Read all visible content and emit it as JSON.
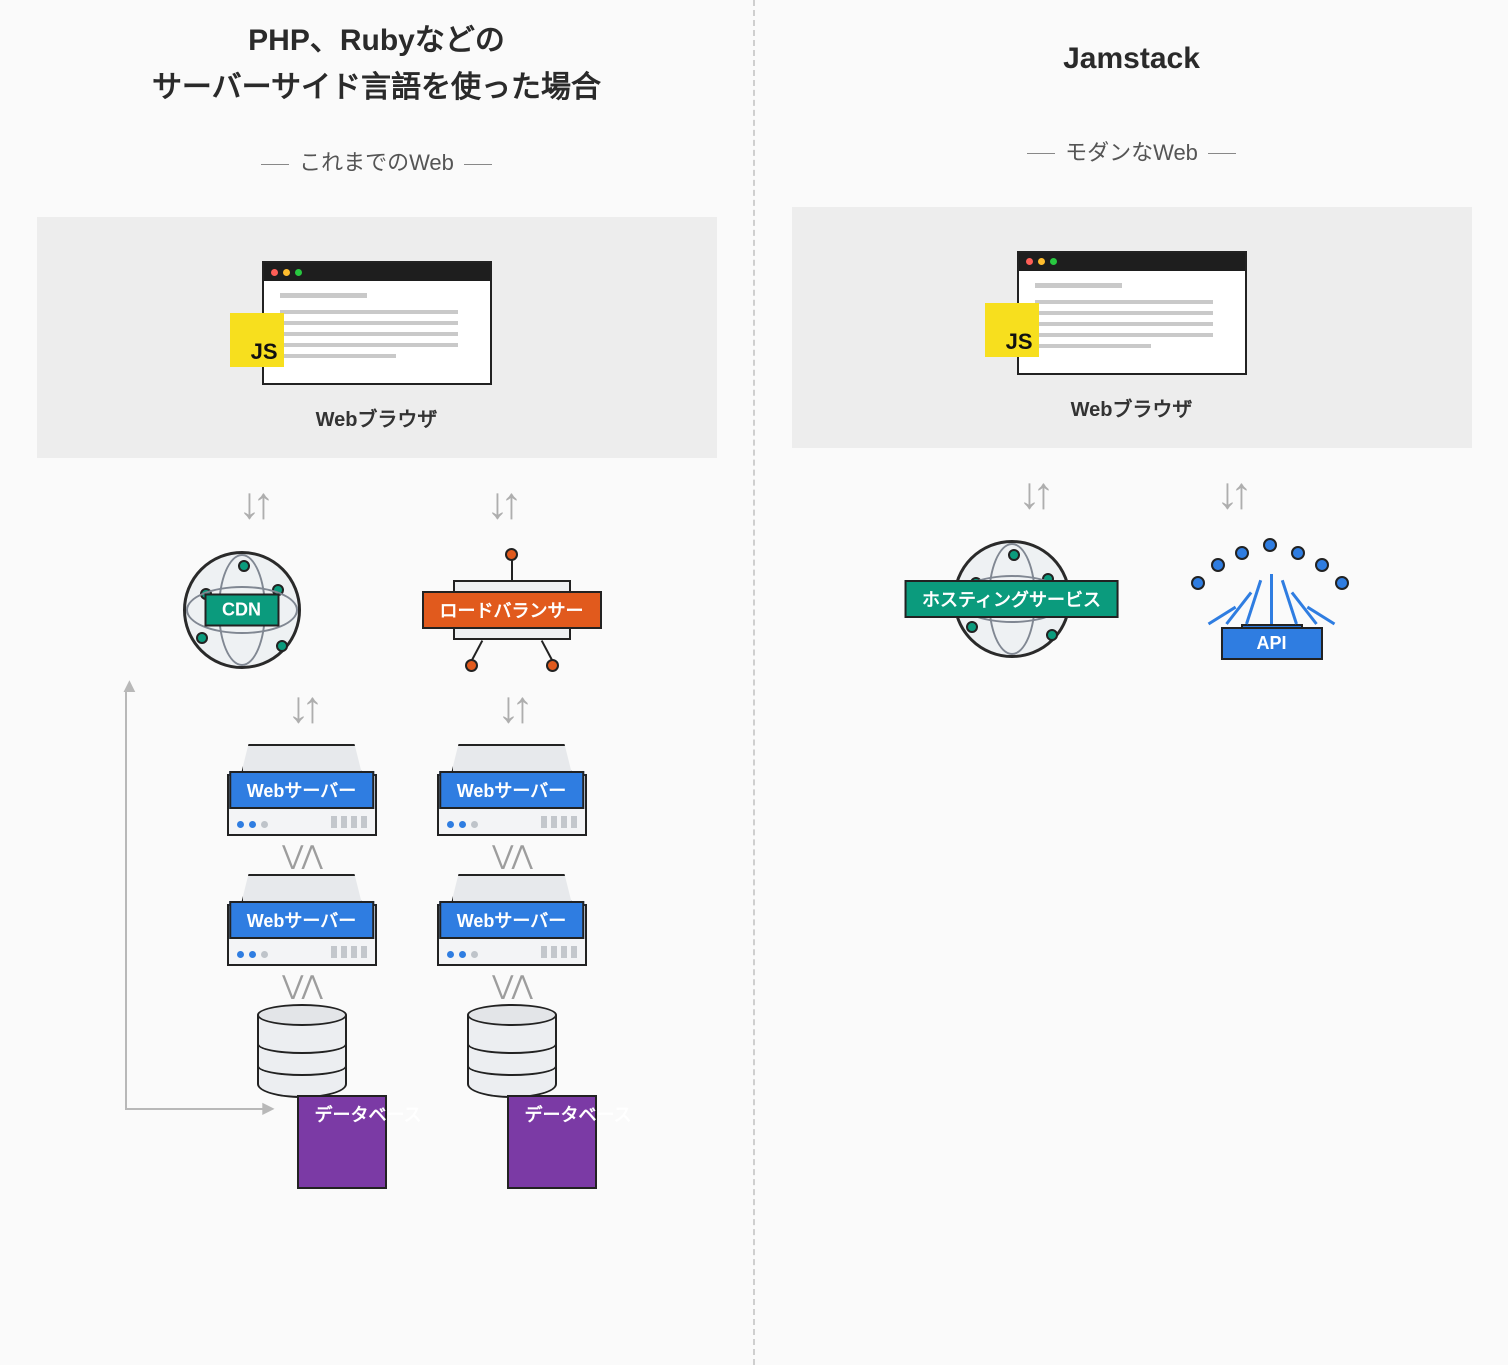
{
  "left": {
    "title_line1": "PHP、Rubyなどの",
    "title_line2": "サーバーサイド言語を使った場合",
    "subtitle": "これまでのWeb",
    "js_badge": "JS",
    "browser_label": "Webブラウザ",
    "nodes": {
      "cdn": "CDN",
      "load_balancer": "ロードバランサー",
      "web_server": "Webサーバー",
      "database": "データベース"
    }
  },
  "right": {
    "title": "Jamstack",
    "subtitle": "モダンなWeb",
    "js_badge": "JS",
    "browser_label": "Webブラウザ",
    "nodes": {
      "hosting": "ホスティングサービス",
      "api": "API"
    }
  }
}
